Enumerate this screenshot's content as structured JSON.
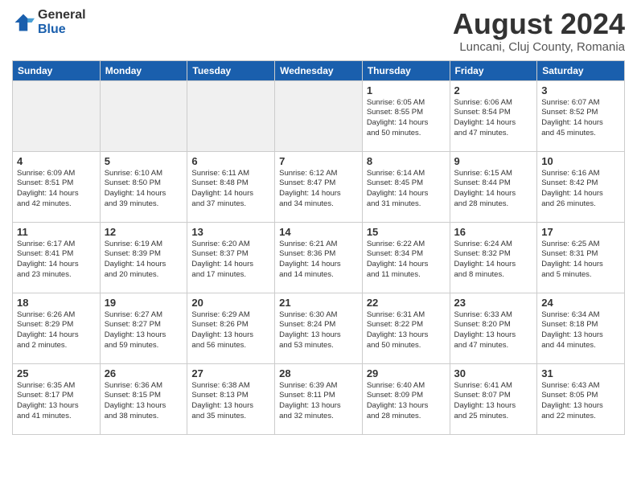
{
  "header": {
    "logo_general": "General",
    "logo_blue": "Blue",
    "title": "August 2024",
    "subtitle": "Luncani, Cluj County, Romania"
  },
  "weekdays": [
    "Sunday",
    "Monday",
    "Tuesday",
    "Wednesday",
    "Thursday",
    "Friday",
    "Saturday"
  ],
  "weeks": [
    [
      {
        "day": "",
        "detail": ""
      },
      {
        "day": "",
        "detail": ""
      },
      {
        "day": "",
        "detail": ""
      },
      {
        "day": "",
        "detail": ""
      },
      {
        "day": "1",
        "detail": "Sunrise: 6:05 AM\nSunset: 8:55 PM\nDaylight: 14 hours\nand 50 minutes."
      },
      {
        "day": "2",
        "detail": "Sunrise: 6:06 AM\nSunset: 8:54 PM\nDaylight: 14 hours\nand 47 minutes."
      },
      {
        "day": "3",
        "detail": "Sunrise: 6:07 AM\nSunset: 8:52 PM\nDaylight: 14 hours\nand 45 minutes."
      }
    ],
    [
      {
        "day": "4",
        "detail": "Sunrise: 6:09 AM\nSunset: 8:51 PM\nDaylight: 14 hours\nand 42 minutes."
      },
      {
        "day": "5",
        "detail": "Sunrise: 6:10 AM\nSunset: 8:50 PM\nDaylight: 14 hours\nand 39 minutes."
      },
      {
        "day": "6",
        "detail": "Sunrise: 6:11 AM\nSunset: 8:48 PM\nDaylight: 14 hours\nand 37 minutes."
      },
      {
        "day": "7",
        "detail": "Sunrise: 6:12 AM\nSunset: 8:47 PM\nDaylight: 14 hours\nand 34 minutes."
      },
      {
        "day": "8",
        "detail": "Sunrise: 6:14 AM\nSunset: 8:45 PM\nDaylight: 14 hours\nand 31 minutes."
      },
      {
        "day": "9",
        "detail": "Sunrise: 6:15 AM\nSunset: 8:44 PM\nDaylight: 14 hours\nand 28 minutes."
      },
      {
        "day": "10",
        "detail": "Sunrise: 6:16 AM\nSunset: 8:42 PM\nDaylight: 14 hours\nand 26 minutes."
      }
    ],
    [
      {
        "day": "11",
        "detail": "Sunrise: 6:17 AM\nSunset: 8:41 PM\nDaylight: 14 hours\nand 23 minutes."
      },
      {
        "day": "12",
        "detail": "Sunrise: 6:19 AM\nSunset: 8:39 PM\nDaylight: 14 hours\nand 20 minutes."
      },
      {
        "day": "13",
        "detail": "Sunrise: 6:20 AM\nSunset: 8:37 PM\nDaylight: 14 hours\nand 17 minutes."
      },
      {
        "day": "14",
        "detail": "Sunrise: 6:21 AM\nSunset: 8:36 PM\nDaylight: 14 hours\nand 14 minutes."
      },
      {
        "day": "15",
        "detail": "Sunrise: 6:22 AM\nSunset: 8:34 PM\nDaylight: 14 hours\nand 11 minutes."
      },
      {
        "day": "16",
        "detail": "Sunrise: 6:24 AM\nSunset: 8:32 PM\nDaylight: 14 hours\nand 8 minutes."
      },
      {
        "day": "17",
        "detail": "Sunrise: 6:25 AM\nSunset: 8:31 PM\nDaylight: 14 hours\nand 5 minutes."
      }
    ],
    [
      {
        "day": "18",
        "detail": "Sunrise: 6:26 AM\nSunset: 8:29 PM\nDaylight: 14 hours\nand 2 minutes."
      },
      {
        "day": "19",
        "detail": "Sunrise: 6:27 AM\nSunset: 8:27 PM\nDaylight: 13 hours\nand 59 minutes."
      },
      {
        "day": "20",
        "detail": "Sunrise: 6:29 AM\nSunset: 8:26 PM\nDaylight: 13 hours\nand 56 minutes."
      },
      {
        "day": "21",
        "detail": "Sunrise: 6:30 AM\nSunset: 8:24 PM\nDaylight: 13 hours\nand 53 minutes."
      },
      {
        "day": "22",
        "detail": "Sunrise: 6:31 AM\nSunset: 8:22 PM\nDaylight: 13 hours\nand 50 minutes."
      },
      {
        "day": "23",
        "detail": "Sunrise: 6:33 AM\nSunset: 8:20 PM\nDaylight: 13 hours\nand 47 minutes."
      },
      {
        "day": "24",
        "detail": "Sunrise: 6:34 AM\nSunset: 8:18 PM\nDaylight: 13 hours\nand 44 minutes."
      }
    ],
    [
      {
        "day": "25",
        "detail": "Sunrise: 6:35 AM\nSunset: 8:17 PM\nDaylight: 13 hours\nand 41 minutes."
      },
      {
        "day": "26",
        "detail": "Sunrise: 6:36 AM\nSunset: 8:15 PM\nDaylight: 13 hours\nand 38 minutes."
      },
      {
        "day": "27",
        "detail": "Sunrise: 6:38 AM\nSunset: 8:13 PM\nDaylight: 13 hours\nand 35 minutes."
      },
      {
        "day": "28",
        "detail": "Sunrise: 6:39 AM\nSunset: 8:11 PM\nDaylight: 13 hours\nand 32 minutes."
      },
      {
        "day": "29",
        "detail": "Sunrise: 6:40 AM\nSunset: 8:09 PM\nDaylight: 13 hours\nand 28 minutes."
      },
      {
        "day": "30",
        "detail": "Sunrise: 6:41 AM\nSunset: 8:07 PM\nDaylight: 13 hours\nand 25 minutes."
      },
      {
        "day": "31",
        "detail": "Sunrise: 6:43 AM\nSunset: 8:05 PM\nDaylight: 13 hours\nand 22 minutes."
      }
    ]
  ]
}
